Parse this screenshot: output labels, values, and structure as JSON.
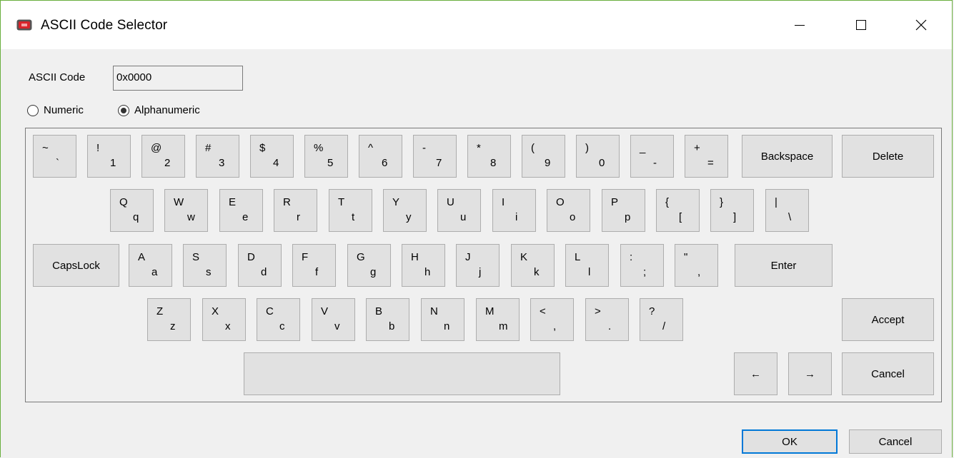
{
  "window": {
    "title": "ASCII Code Selector",
    "accent_border": "#6aaf3e"
  },
  "form": {
    "ascii_label": "ASCII Code",
    "ascii_value": "0x0000",
    "radio_numeric": "Numeric",
    "radio_alphanumeric": "Alphanumeric",
    "selected_mode": "Alphanumeric"
  },
  "keyboard": {
    "row1": [
      {
        "upper": "~",
        "lower": "`"
      },
      {
        "upper": "!",
        "lower": "1"
      },
      {
        "upper": "@",
        "lower": "2"
      },
      {
        "upper": "#",
        "lower": "3"
      },
      {
        "upper": "$",
        "lower": "4"
      },
      {
        "upper": "%",
        "lower": "5"
      },
      {
        "upper": "^",
        "lower": "6"
      },
      {
        "upper": "-",
        "lower": "7"
      },
      {
        "upper": "*",
        "lower": "8"
      },
      {
        "upper": "(",
        "lower": "9"
      },
      {
        "upper": ")",
        "lower": "0"
      },
      {
        "upper": "_",
        "lower": "-"
      },
      {
        "upper": "+",
        "lower": "="
      }
    ],
    "row2": [
      {
        "upper": "Q",
        "lower": "q"
      },
      {
        "upper": "W",
        "lower": "w"
      },
      {
        "upper": "E",
        "lower": "e"
      },
      {
        "upper": "R",
        "lower": "r"
      },
      {
        "upper": "T",
        "lower": "t"
      },
      {
        "upper": "Y",
        "lower": "y"
      },
      {
        "upper": "U",
        "lower": "u"
      },
      {
        "upper": "I",
        "lower": "i"
      },
      {
        "upper": "O",
        "lower": "o"
      },
      {
        "upper": "P",
        "lower": "p"
      },
      {
        "upper": "{",
        "lower": "["
      },
      {
        "upper": "}",
        "lower": "]"
      },
      {
        "upper": "|",
        "lower": "\\"
      }
    ],
    "row3": [
      {
        "upper": "A",
        "lower": "a"
      },
      {
        "upper": "S",
        "lower": "s"
      },
      {
        "upper": "D",
        "lower": "d"
      },
      {
        "upper": "F",
        "lower": "f"
      },
      {
        "upper": "G",
        "lower": "g"
      },
      {
        "upper": "H",
        "lower": "h"
      },
      {
        "upper": "J",
        "lower": "j"
      },
      {
        "upper": "K",
        "lower": "k"
      },
      {
        "upper": "L",
        "lower": "l"
      },
      {
        "upper": ":",
        "lower": ";"
      },
      {
        "upper": "\"",
        "lower": ","
      }
    ],
    "row4": [
      {
        "upper": "Z",
        "lower": "z"
      },
      {
        "upper": "X",
        "lower": "x"
      },
      {
        "upper": "C",
        "lower": "c"
      },
      {
        "upper": "V",
        "lower": "v"
      },
      {
        "upper": "B",
        "lower": "b"
      },
      {
        "upper": "N",
        "lower": "n"
      },
      {
        "upper": "M",
        "lower": "m"
      },
      {
        "upper": "<",
        "lower": ","
      },
      {
        "upper": ">",
        "lower": "."
      },
      {
        "upper": "?",
        "lower": "/"
      }
    ],
    "backspace": "Backspace",
    "delete": "Delete",
    "capslock": "CapsLock",
    "enter": "Enter",
    "accept": "Accept",
    "cancel": "Cancel",
    "left_arrow": "←",
    "right_arrow": "→"
  },
  "footer": {
    "ok": "OK",
    "cancel": "Cancel"
  }
}
